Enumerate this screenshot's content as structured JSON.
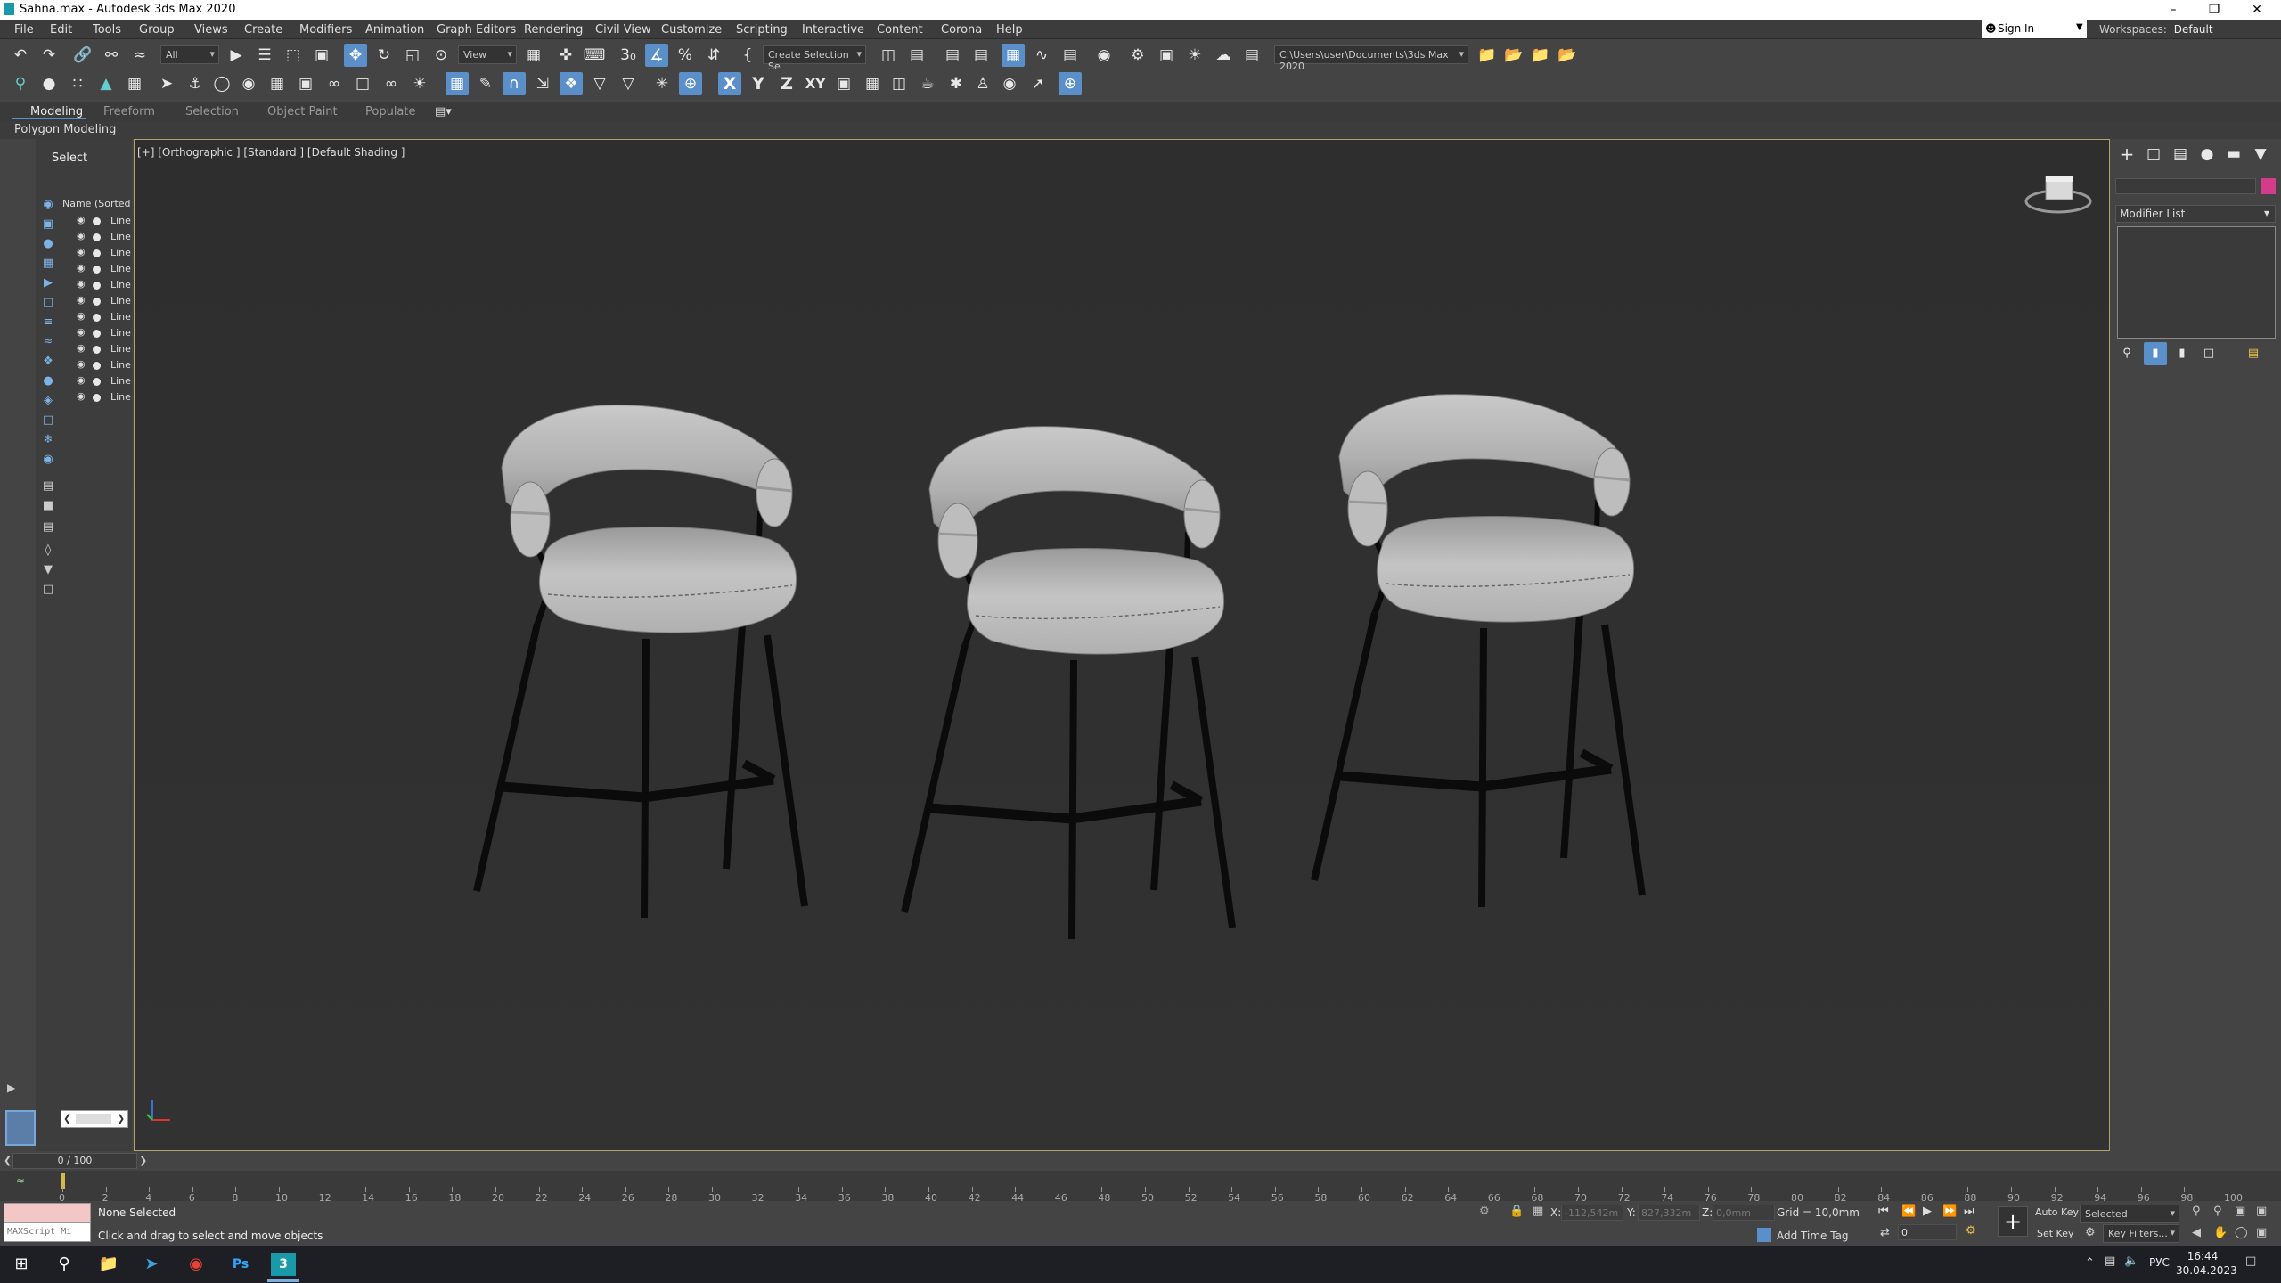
{
  "window": {
    "title": "Sahna.max - Autodesk 3ds Max 2020"
  },
  "menu": [
    "File",
    "Edit",
    "Tools",
    "Group",
    "Views",
    "Create",
    "Modifiers",
    "Animation",
    "Graph Editors",
    "Rendering",
    "Civil View",
    "Customize",
    "Scripting",
    "Interactive",
    "Content",
    "Corona",
    "Help"
  ],
  "account": {
    "sign_in": "Sign In",
    "workspaces_label": "Workspaces:",
    "workspace": "Default"
  },
  "toolbar": {
    "selection_filter": "All",
    "ref_coord": "View",
    "named_selection": "Create Selection Se",
    "project_path": "C:\\Users\\user\\Documents\\3ds Max 2020",
    "axis_x": "X",
    "axis_y": "Y",
    "axis_z": "Z",
    "axis_xy": "XY"
  },
  "ribbon": {
    "tabs": [
      "Modeling",
      "Freeform",
      "Selection",
      "Object Paint",
      "Populate"
    ],
    "panel": "Polygon Modeling"
  },
  "scene_explorer": {
    "title": "Select",
    "column": "Name (Sorted A",
    "rows": [
      "Line",
      "Line",
      "Line",
      "Line",
      "Line",
      "Line",
      "Line",
      "Line",
      "Line",
      "Line",
      "Line",
      "Line"
    ]
  },
  "viewport": {
    "label": "[+] [Orthographic ] [Standard ] [Default Shading ]"
  },
  "command_panel": {
    "modifier_list": "Modifier List"
  },
  "timeline": {
    "frame": "0 / 100",
    "ticks": [
      "0",
      "2",
      "4",
      "6",
      "8",
      "10",
      "12",
      "14",
      "16",
      "18",
      "20",
      "22",
      "24",
      "26",
      "28",
      "30",
      "32",
      "34",
      "36",
      "38",
      "40",
      "42",
      "44",
      "46",
      "48",
      "50",
      "52",
      "54",
      "56",
      "58",
      "60",
      "62",
      "64",
      "66",
      "68",
      "70",
      "72",
      "74",
      "76",
      "78",
      "80",
      "82",
      "84",
      "86",
      "88",
      "90",
      "92",
      "94",
      "96",
      "98",
      "100"
    ]
  },
  "status": {
    "maxscript": "MAXScript Mi",
    "line1": "None Selected",
    "line2": "Click and drag to select and move objects",
    "x_label": "X:",
    "x": "-112,542m",
    "y_label": "Y:",
    "y": "827,332m",
    "z_label": "Z:",
    "z": "0,0mm",
    "grid": "Grid = 10,0mm",
    "add_time_tag": "Add Time Tag",
    "auto_key": "Auto Key",
    "key_mode": "Selected",
    "set_key": "Set Key",
    "key_filters": "Key Filters...",
    "frame_field": "0"
  },
  "taskbar": {
    "lang": "РУС",
    "time": "16:44",
    "date": "30.04.2023"
  }
}
